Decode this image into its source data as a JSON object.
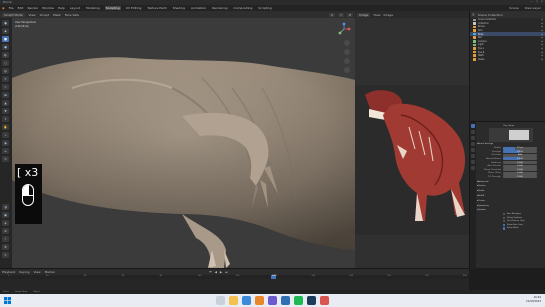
{
  "titlebar": {
    "title": "Blender",
    "controls": [
      "—",
      "□",
      "✕"
    ]
  },
  "menubar": {
    "items": [
      "File",
      "Edit",
      "Render",
      "Window",
      "Help"
    ],
    "workspaces": [
      "Layout",
      "Modeling",
      "Sculpting",
      "UV Editing",
      "Texture Paint",
      "Shading",
      "Animation",
      "Rendering",
      "Compositing",
      "Scripting"
    ],
    "active_workspace": "Sculpting",
    "right": [
      "Scene",
      "View Layer"
    ]
  },
  "viewport_header": {
    "mode": "Sculpt Mode",
    "menus": [
      "View",
      "Sculpt",
      "Mask",
      "Face Sets"
    ],
    "right": [
      "X",
      "Y",
      "Z"
    ]
  },
  "viewport_info": {
    "line1": "User Perspective",
    "line2": "(140) Body"
  },
  "key_overlay": {
    "text": "[ x3"
  },
  "reference_panel": {
    "mode": "Image",
    "menus": [
      "View",
      "Image"
    ]
  },
  "outliner": {
    "header": "Scene Collection",
    "rows": [
      {
        "label": "Scene Collection",
        "color": "#9a9a9a",
        "selected": false
      },
      {
        "label": "Collection",
        "color": "#c9c9c9",
        "selected": false
      },
      {
        "label": "Bones",
        "color": "#e6a23c",
        "selected": false
      },
      {
        "label": "Skin",
        "color": "#e6a23c",
        "selected": false
      },
      {
        "label": "Body",
        "color": "#5aa9e6",
        "selected": true
      },
      {
        "label": "Ref",
        "color": "#e6a23c",
        "selected": false
      },
      {
        "label": "Camera",
        "color": "#7ec27e",
        "selected": false
      },
      {
        "label": "Light",
        "color": "#7ec27e",
        "selected": false
      },
      {
        "label": "Eye.L",
        "color": "#e6a23c",
        "selected": false
      },
      {
        "label": "Eye.R",
        "color": "#e6a23c",
        "selected": false
      },
      {
        "label": "Teeth",
        "color": "#e6a23c",
        "selected": false
      },
      {
        "label": "Claws",
        "color": "#e6a23c",
        "selected": false
      }
    ]
  },
  "properties": {
    "brush_name": "Clay Strips",
    "brush_settings_label": "Brush Settings",
    "fields": [
      {
        "label": "Radius",
        "value": "57 px",
        "fill": 0.35
      },
      {
        "label": "Strength",
        "value": "0.500",
        "fill": 0.5
      },
      {
        "label": "Direction",
        "value": "Add",
        "fill": 0
      },
      {
        "label": "Normal Radius",
        "value": "0.500",
        "fill": 0.5
      },
      {
        "label": "Hardness",
        "value": "0.000",
        "fill": 0
      },
      {
        "label": "Auto Smooth",
        "value": "0.000",
        "fill": 0
      },
      {
        "label": "Sharp Threshold",
        "value": "0.000",
        "fill": 0
      },
      {
        "label": "Plane Offset",
        "value": "0.000",
        "fill": 0
      },
      {
        "label": "Tilt Strength",
        "value": "0.000",
        "fill": 0
      }
    ],
    "sections": [
      "Advanced",
      "Texture",
      "Stroke",
      "Falloff",
      "Cursor",
      "Symmetry",
      "Options"
    ],
    "checks": [
      {
        "label": "Fast Navigate",
        "on": false
      },
      {
        "label": "Delay Updates",
        "on": false
      },
      {
        "label": "Use Deform Only",
        "on": false
      },
      {
        "label": "Show Face Sets",
        "on": true
      },
      {
        "label": "Show Mask",
        "on": true
      }
    ]
  },
  "timeline": {
    "menus": [
      "Playback",
      "Keying",
      "View",
      "Marker"
    ],
    "ticks": [
      "0",
      "20",
      "40",
      "60",
      "80",
      "100",
      "120",
      "140",
      "160",
      "180",
      "200",
      "220",
      "240"
    ],
    "current_frame": "140"
  },
  "statusbar": {
    "items": [
      "Select",
      "Rotate View",
      "Object"
    ]
  },
  "taskbar": {
    "time": "10:42",
    "date": "21/03/2023"
  }
}
